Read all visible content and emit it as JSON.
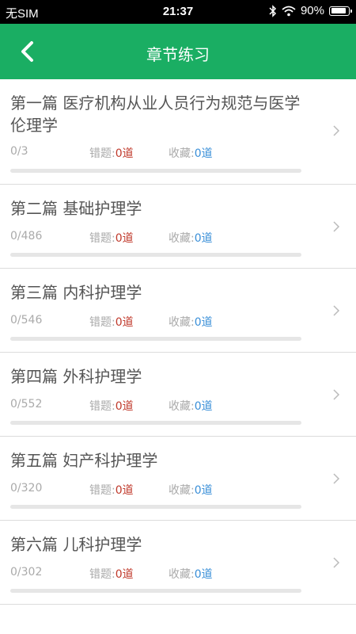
{
  "status": {
    "carrier": "无SIM",
    "time": "21:37",
    "battery": "90%",
    "battery_level": 0.9
  },
  "nav": {
    "title": "章节练习"
  },
  "labels": {
    "wrong": "错题:",
    "fav": "收藏:"
  },
  "chapters": [
    {
      "name": "第一篇 医疗机构从业人员行为规范与医学伦理学",
      "progress": "0/3",
      "wrong": "0道",
      "fav": "0道",
      "done_fraction": 0
    },
    {
      "name": "第二篇 基础护理学",
      "progress": "0/486",
      "wrong": "0道",
      "fav": "0道",
      "done_fraction": 0
    },
    {
      "name": "第三篇 内科护理学",
      "progress": "0/546",
      "wrong": "0道",
      "fav": "0道",
      "done_fraction": 0
    },
    {
      "name": "第四篇 外科护理学",
      "progress": "0/552",
      "wrong": "0道",
      "fav": "0道",
      "done_fraction": 0
    },
    {
      "name": "第五篇 妇产科护理学",
      "progress": "0/320",
      "wrong": "0道",
      "fav": "0道",
      "done_fraction": 0
    },
    {
      "name": "第六篇 儿科护理学",
      "progress": "0/302",
      "wrong": "0道",
      "fav": "0道",
      "done_fraction": 0
    }
  ]
}
